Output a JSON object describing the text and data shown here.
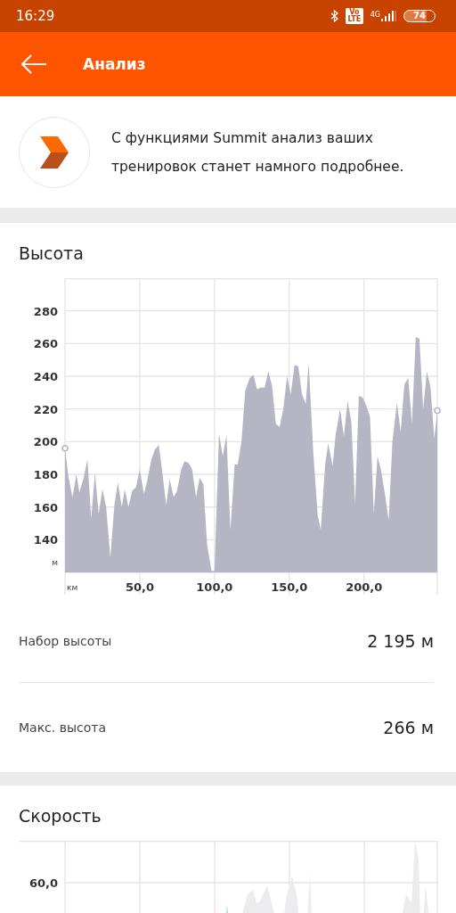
{
  "status_bar": {
    "time": "16:29",
    "volte": "Vo LTE",
    "network": "4G",
    "battery": "74"
  },
  "toolbar": {
    "title": "Анализ"
  },
  "promo": {
    "text": "С функциями Summit анализ ваших тренировок станет намного подробнее."
  },
  "elevation": {
    "title": "Высота",
    "chart_data": {
      "type": "area",
      "xlabel": "км",
      "ylabel": "м",
      "xlim": [
        0,
        249
      ],
      "ylim": [
        120,
        300
      ],
      "grid": true,
      "xticks": [
        {
          "value": 50,
          "label": "50,0"
        },
        {
          "value": 100,
          "label": "100,0"
        },
        {
          "value": 150,
          "label": "150,0"
        },
        {
          "value": 200,
          "label": "200,0"
        }
      ],
      "yticks": [
        140,
        160,
        180,
        200,
        220,
        240,
        260,
        280
      ],
      "x": [
        0,
        2.4,
        5,
        7.6,
        9.6,
        12.5,
        15,
        17.5,
        20,
        22.5,
        25,
        27.5,
        30.3,
        33,
        35.3,
        38,
        40,
        42.4,
        45,
        47.4,
        50,
        52.8,
        55,
        57.8,
        60,
        62.7,
        65,
        67.7,
        70,
        72.7,
        75,
        77.7,
        80,
        82.7,
        85,
        87.6,
        90,
        92.6,
        95,
        98,
        100,
        103,
        105.5,
        108,
        110.6,
        113.5,
        115.5,
        118,
        120.5,
        123.6,
        126,
        128.5,
        131,
        133.5,
        136,
        138.5,
        141,
        143.5,
        146,
        148.5,
        151,
        153.5,
        156,
        158.5,
        161,
        163,
        166,
        169,
        171,
        174,
        176,
        179,
        181,
        184,
        186.5,
        189,
        191.5,
        194,
        196.5,
        199,
        201.5,
        204,
        206.5,
        209,
        211.5,
        214,
        216.5,
        219,
        222,
        224.5,
        227,
        229.5,
        232,
        234.6,
        237,
        239.6,
        242,
        244.5,
        247,
        249
      ],
      "series": [
        {
          "color": "#b6b5c4",
          "values": [
            196,
            178,
            166,
            180,
            169,
            178,
            189,
            153,
            181,
            156,
            171,
            160,
            129,
            161,
            175,
            160,
            171,
            160,
            170,
            172,
            183,
            168,
            176,
            189,
            195,
            198,
            182,
            161,
            177,
            166,
            170,
            183,
            188,
            187,
            183,
            166,
            178,
            174,
            137,
            121,
            121,
            205,
            191,
            204,
            146,
            186,
            186,
            200,
            231,
            239,
            241,
            232,
            233,
            233,
            243,
            234,
            211,
            209,
            220,
            240,
            229,
            247,
            246,
            229,
            223,
            248,
            194,
            155,
            146,
            186,
            199,
            185,
            204,
            220,
            203,
            225,
            212,
            162,
            228,
            227,
            222,
            215,
            156,
            191,
            182,
            168,
            152,
            200,
            224,
            206,
            235,
            239,
            211,
            264,
            263,
            220,
            243,
            233,
            202,
            219
          ]
        }
      ]
    }
  },
  "stats": [
    {
      "label": "Набор высоты",
      "value": "2 195 м"
    },
    {
      "label": "Макс. высота",
      "value": "266 м"
    }
  ],
  "speed": {
    "title": "Скорость",
    "y_tick_label": "60,0"
  }
}
